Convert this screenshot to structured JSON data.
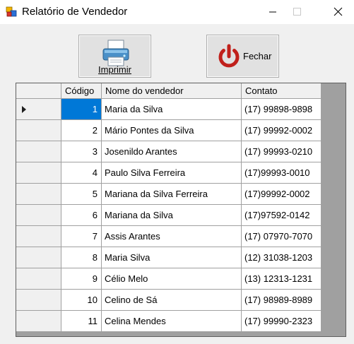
{
  "window": {
    "title": "Relatório de Vendedor",
    "icon": "app-form-icon"
  },
  "toolbar": {
    "print_label": "Imprimir",
    "print_icon": "printer-icon",
    "close_label": "Fechar",
    "close_icon": "power-icon",
    "close_icon_color": "#c0201b"
  },
  "grid": {
    "columns": [
      "Código",
      "Nome do vendedor",
      "Contato"
    ],
    "selected_row": 0,
    "selection_color": "#0078d7",
    "rows": [
      {
        "codigo": "1",
        "nome": "Maria da Silva",
        "contato": "(17) 99898-9898"
      },
      {
        "codigo": "2",
        "nome": "Mário Pontes da Silva",
        "contato": "(17) 99992-0002"
      },
      {
        "codigo": "3",
        "nome": "Josenildo Arantes",
        "contato": "(17) 99993-0210"
      },
      {
        "codigo": "4",
        "nome": "Paulo Silva Ferreira",
        "contato": "(17)99993-0010"
      },
      {
        "codigo": "5",
        "nome": "Mariana da Silva Ferreira",
        "contato": "(17)99992-0002"
      },
      {
        "codigo": "6",
        "nome": "Mariana da Silva",
        "contato": "(17)97592-0142"
      },
      {
        "codigo": "7",
        "nome": "Assis Arantes",
        "contato": "(17) 07970-7070"
      },
      {
        "codigo": "8",
        "nome": "Maria Silva",
        "contato": "(12) 31038-1203"
      },
      {
        "codigo": "9",
        "nome": "Célio Melo",
        "contato": "(13) 12313-1231"
      },
      {
        "codigo": "10",
        "nome": "Celino de Sá",
        "contato": "(17) 98989-8989"
      },
      {
        "codigo": "11",
        "nome": "Celina Mendes",
        "contato": "(17) 99990-2323"
      }
    ]
  }
}
